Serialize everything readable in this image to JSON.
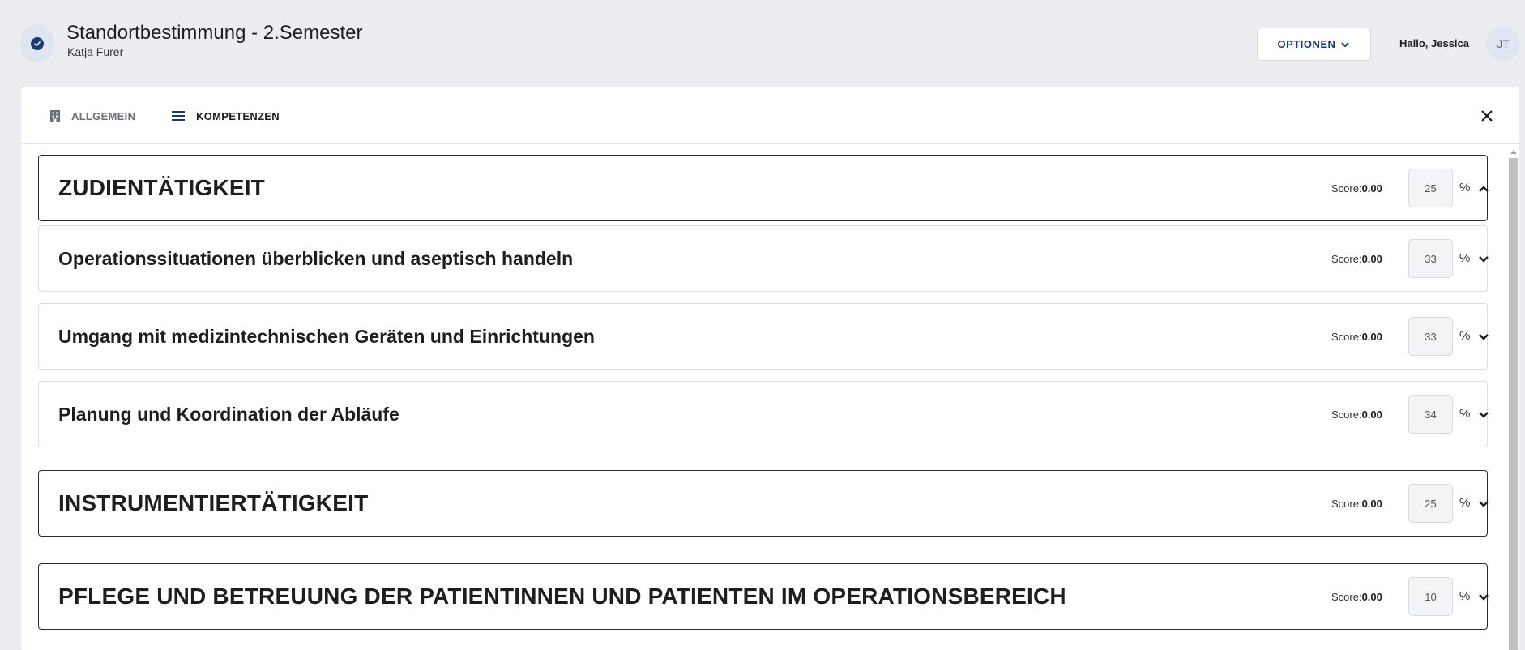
{
  "header": {
    "title": "Standortbestimmung - 2.Semester",
    "subtitle": "Katja Furer",
    "options_label": "OPTIONEN",
    "greeting": "Hallo, Jessica",
    "avatar_initials": "JT",
    "status_icon": "check-circle-icon"
  },
  "tabs": [
    {
      "label": "ALLGEMEIN",
      "icon": "building-icon",
      "active": false
    },
    {
      "label": "KOMPETENZEN",
      "icon": "list-icon",
      "active": true
    }
  ],
  "score_label": "Score:",
  "percent_sign": "%",
  "sections": [
    {
      "title": "ZUDIENTÄTIGKEIT",
      "level": "main",
      "score": "0.00",
      "weight": "25",
      "expanded": true
    },
    {
      "title": "Operationssituationen überblicken und aseptisch handeln",
      "level": "sub",
      "score": "0.00",
      "weight": "33",
      "expanded": false
    },
    {
      "title": "Umgang mit medizintechnischen Geräten und Einrichtungen",
      "level": "sub",
      "score": "0.00",
      "weight": "33",
      "expanded": false
    },
    {
      "title": "Planung und Koordination der Abläufe",
      "level": "sub",
      "score": "0.00",
      "weight": "34",
      "expanded": false
    },
    {
      "title": "INSTRUMENTIERTÄTIGKEIT",
      "level": "main",
      "score": "0.00",
      "weight": "25",
      "expanded": false
    },
    {
      "title": "PFLEGE UND BETREUUNG DER PATIENTINNEN UND PATIENTEN IM OPERATIONSBEREICH",
      "level": "main",
      "score": "0.00",
      "weight": "10",
      "expanded": false
    }
  ],
  "colors": {
    "accent": "#1a3a74",
    "background": "#ecedf0"
  }
}
